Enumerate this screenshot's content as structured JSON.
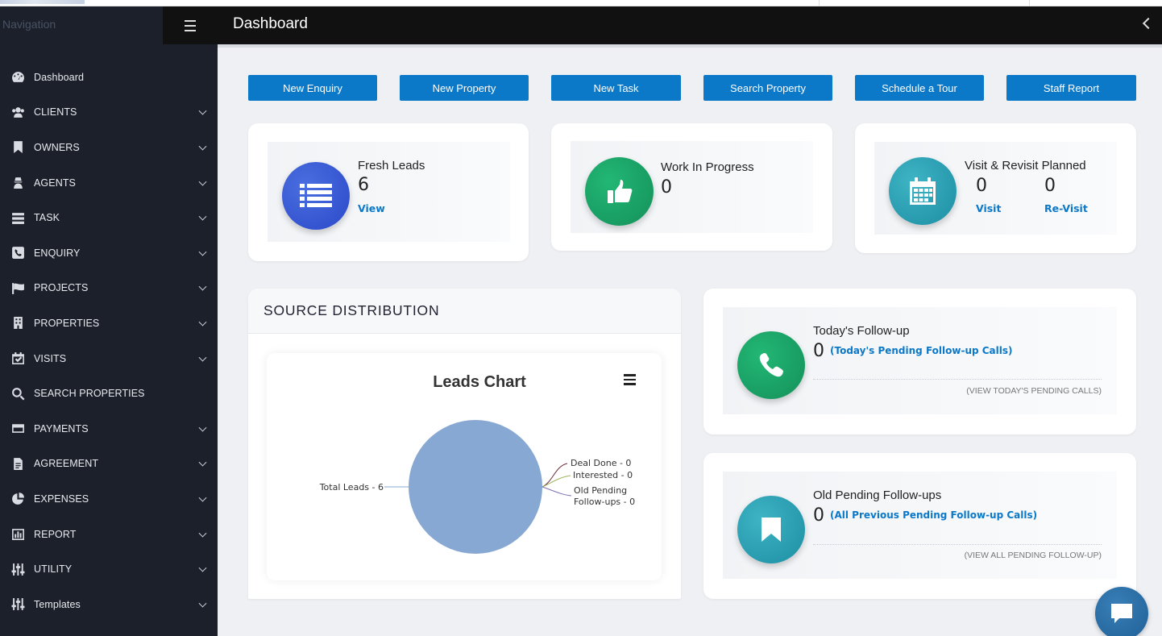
{
  "sidebar": {
    "nav_title": "Navigation",
    "items": [
      {
        "label": "Dashboard",
        "icon": "dashboard-icon",
        "has_submenu": false
      },
      {
        "label": "CLIENTS",
        "icon": "users-icon",
        "has_submenu": true
      },
      {
        "label": "OWNERS",
        "icon": "bookmark-icon",
        "has_submenu": true
      },
      {
        "label": "AGENTS",
        "icon": "agent-icon",
        "has_submenu": true
      },
      {
        "label": "TASK",
        "icon": "tasks-icon",
        "has_submenu": true
      },
      {
        "label": "ENQUIRY",
        "icon": "phone-icon",
        "has_submenu": true
      },
      {
        "label": "PROJECTS",
        "icon": "flag-icon",
        "has_submenu": true
      },
      {
        "label": "PROPERTIES",
        "icon": "building-icon",
        "has_submenu": true
      },
      {
        "label": "VISITS",
        "icon": "calendar-check-icon",
        "has_submenu": true
      },
      {
        "label": "SEARCH PROPERTIES",
        "icon": "search-icon",
        "has_submenu": false
      },
      {
        "label": "PAYMENTS",
        "icon": "credit-card-icon",
        "has_submenu": true
      },
      {
        "label": "AGREEMENT",
        "icon": "file-icon",
        "has_submenu": true
      },
      {
        "label": "EXPENSES",
        "icon": "pie-chart-icon",
        "has_submenu": true
      },
      {
        "label": "REPORT",
        "icon": "bar-chart-icon",
        "has_submenu": true
      },
      {
        "label": "UTILITY",
        "icon": "sliders-icon",
        "has_submenu": true
      },
      {
        "label": "Templates",
        "icon": "sliders-icon",
        "has_submenu": true
      }
    ]
  },
  "header": {
    "title": "Dashboard"
  },
  "actions": [
    {
      "label": "New Enquiry"
    },
    {
      "label": "New Property"
    },
    {
      "label": "New Task"
    },
    {
      "label": "Search Property"
    },
    {
      "label": "Schedule a Tour"
    },
    {
      "label": "Staff Report"
    }
  ],
  "stats": {
    "fresh_leads": {
      "title": "Fresh Leads",
      "value": "6",
      "link": "View"
    },
    "work_in_progress": {
      "title": "Work In Progress",
      "value": "0"
    },
    "visits": {
      "title": "Visit & Revisit Planned",
      "visit_value": "0",
      "visit_link": "Visit",
      "revisit_value": "0",
      "revisit_link": "Re-Visit"
    }
  },
  "source_distribution": {
    "title": "SOURCE DISTRIBUTION"
  },
  "chart_data": {
    "type": "pie",
    "title": "Leads Chart",
    "slices": [
      {
        "label": "Total Leads",
        "value": 6,
        "display": "Total Leads - 6",
        "color": "#87a8d3"
      },
      {
        "label": "Deal Done",
        "value": 0,
        "display": "Deal Done - 0",
        "color": "#6b2c3a"
      },
      {
        "label": "Interested",
        "value": 0,
        "display": "Interested - 0",
        "color": "#9bb55a"
      },
      {
        "label": "Old Pending Follow-ups",
        "value": 0,
        "display_line1": "Old Pending",
        "display_line2": "Follow-ups - 0",
        "color": "#7d6fb0"
      }
    ]
  },
  "followups": {
    "today": {
      "title": "Today's Follow-up",
      "value": "0",
      "sub": "(Today's Pending Follow-up Calls)",
      "link": "(VIEW TODAY'S PENDING CALLS)"
    },
    "old": {
      "title": "Old Pending Follow-ups",
      "value": "0",
      "sub": "(All Previous Pending Follow-up Calls)",
      "link": "(VIEW ALL PENDING FOLLOW-UP)"
    }
  },
  "colors": {
    "accent": "#0b78c8",
    "sidebar_bg": "#1b202b",
    "header_bg": "#111111"
  }
}
